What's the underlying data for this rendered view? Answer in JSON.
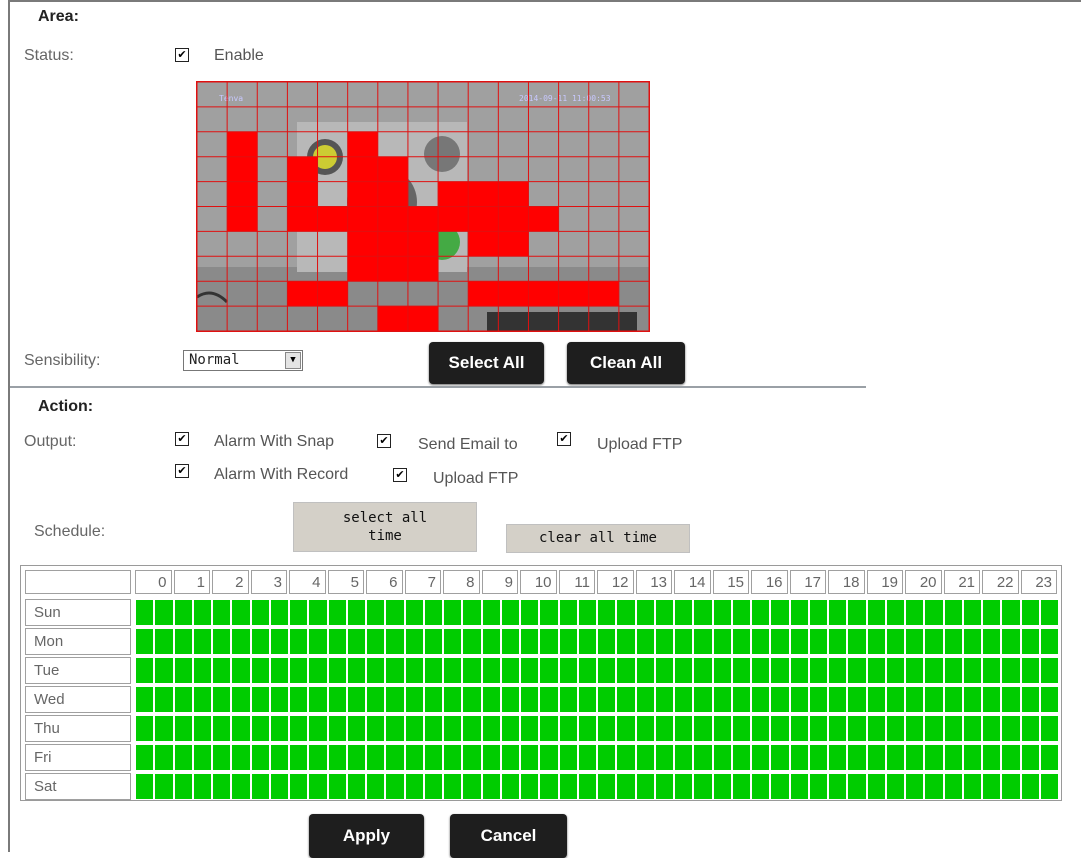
{
  "area": {
    "title": "Area:",
    "status_label": "Status:",
    "enable_label": "Enable",
    "enable_checked": true,
    "preview": {
      "overlay_left": "Tenva",
      "overlay_right": "2014-09-11 11:00:53",
      "grid_cols": 15,
      "grid_rows": 10,
      "active_cells": [
        [
          1,
          2
        ],
        [
          1,
          3
        ],
        [
          1,
          4
        ],
        [
          1,
          5
        ],
        [
          5,
          2
        ],
        [
          3,
          3
        ],
        [
          5,
          3
        ],
        [
          6,
          3
        ],
        [
          3,
          4
        ],
        [
          5,
          4
        ],
        [
          6,
          4
        ],
        [
          8,
          4
        ],
        [
          9,
          4
        ],
        [
          10,
          4
        ],
        [
          3,
          5
        ],
        [
          4,
          5
        ],
        [
          5,
          5
        ],
        [
          6,
          5
        ],
        [
          7,
          5
        ],
        [
          8,
          5
        ],
        [
          9,
          5
        ],
        [
          10,
          5
        ],
        [
          11,
          5
        ],
        [
          5,
          6
        ],
        [
          6,
          6
        ],
        [
          7,
          6
        ],
        [
          9,
          6
        ],
        [
          10,
          6
        ],
        [
          5,
          7
        ],
        [
          6,
          7
        ],
        [
          7,
          7
        ],
        [
          3,
          8
        ],
        [
          4,
          8
        ],
        [
          9,
          8
        ],
        [
          10,
          8
        ],
        [
          11,
          8
        ],
        [
          12,
          8
        ],
        [
          13,
          8
        ],
        [
          6,
          9
        ],
        [
          7,
          9
        ]
      ]
    }
  },
  "sensibility": {
    "label": "Sensibility:",
    "value": "Normal"
  },
  "buttons": {
    "select_all": "Select All",
    "clean_all": "Clean All",
    "select_all_time": "select all\ntime",
    "select_all_time_line1": "select all",
    "select_all_time_line2": "time",
    "clear_all_time": "clear all time",
    "apply": "Apply",
    "cancel": "Cancel"
  },
  "action": {
    "title": "Action:",
    "output_label": "Output:",
    "alarm_with_snap": "Alarm With Snap",
    "send_email_to": "Send Email to",
    "upload_ftp_1": "Upload FTP",
    "alarm_with_record": "Alarm With Record",
    "upload_ftp_2": "Upload FTP",
    "checks": {
      "alarm_with_snap": true,
      "send_email_to": true,
      "upload_ftp_1": true,
      "alarm_with_record": true,
      "upload_ftp_2": true
    }
  },
  "schedule": {
    "label": "Schedule:",
    "hours": [
      "0",
      "1",
      "2",
      "3",
      "4",
      "5",
      "6",
      "7",
      "8",
      "9",
      "10",
      "11",
      "12",
      "13",
      "14",
      "15",
      "16",
      "17",
      "18",
      "19",
      "20",
      "21",
      "22",
      "23"
    ],
    "days": [
      "Sun",
      "Mon",
      "Tue",
      "Wed",
      "Thu",
      "Fri",
      "Sat"
    ],
    "all_selected": true,
    "slot_color": "#00cc00"
  },
  "colors": {
    "motion_cell": "#ff0000",
    "grid_line": "#e01010",
    "button_dark": "#1e1e1e",
    "button_gray": "#d4d0c8"
  }
}
